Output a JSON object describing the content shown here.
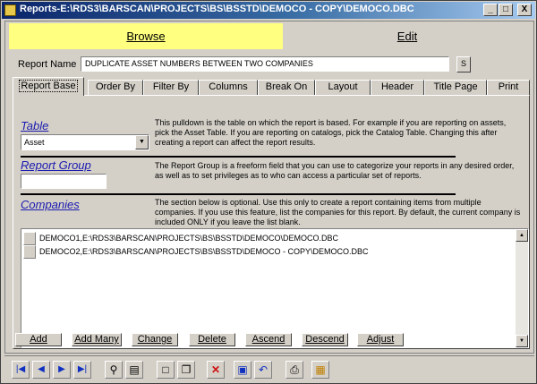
{
  "window": {
    "title": "Reports-E:\\RDS3\\BARSCAN\\PROJECTS\\BS\\BSSTD\\DEMOCO - COPY\\DEMOCO.DBC",
    "minimize": "_",
    "maximize": "□",
    "close": "X"
  },
  "mode_tabs": {
    "browse": "Browse",
    "edit": "Edit"
  },
  "report_name": {
    "label": "Report Name",
    "value": "DUPLICATE ASSET NUMBERS BETWEEN TWO COMPANIES",
    "s_button": "S"
  },
  "subtabs": [
    "Report Base",
    "Order By",
    "Filter By",
    "Columns",
    "Break On",
    "Layout",
    "Header",
    "Title Page",
    "Print"
  ],
  "table_section": {
    "title": "Table",
    "selected": "Asset",
    "description": "This pulldown is the table on which the report is based.  For example if you are reporting on assets, pick the Asset Table.  If you are reporting on catalogs, pick the Catalog Table.  Changing this after creating a report can affect the report results."
  },
  "group_section": {
    "title": "Report Group",
    "value": "",
    "description": "The Report Group is a freeform field that you can use to categorize your reports in any desired order, as well as to set privileges as to who can access a particular set of reports."
  },
  "companies_section": {
    "title": "Companies",
    "description": "The section below is optional.  Use this only to create a report containing items from multiple companies.  If you use this feature, list the companies for this report.  By default, the current company is included ONLY if you leave the list blank.",
    "rows": [
      "DEMOCO1,E:\\RDS3\\BARSCAN\\PROJECTS\\BS\\BSSTD\\DEMOCO\\DEMOCO.DBC",
      "DEMOCO2,E:\\RDS3\\BARSCAN\\PROJECTS\\BS\\BSSTD\\DEMOCO - COPY\\DEMOCO.DBC"
    ]
  },
  "actions": [
    "Add",
    "Add Many",
    "Change",
    "Delete",
    "Ascend",
    "Descend",
    "Adjust"
  ],
  "toolbar_icons": [
    "first-record-icon",
    "previous-record-icon",
    "next-record-icon",
    "last-record-icon",
    "binoculars-icon",
    "search-form-icon",
    "new-document-icon",
    "copy-document-icon",
    "delete-x-icon",
    "save-disk-icon",
    "undo-icon",
    "print-icon",
    "print-preview-icon"
  ]
}
